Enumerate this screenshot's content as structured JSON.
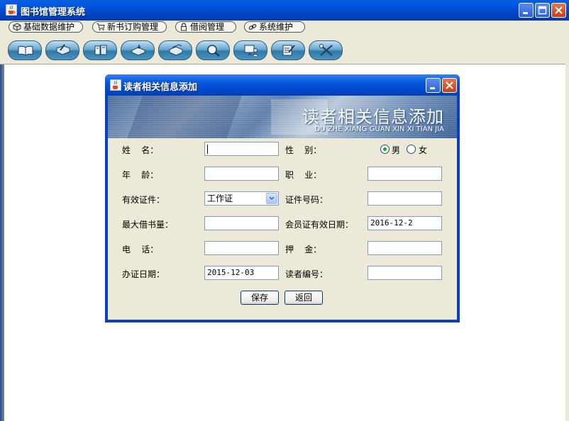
{
  "app": {
    "title": "图书馆管理系统"
  },
  "menu": [
    {
      "label": "基础数据维护",
      "icon": "cube-icon"
    },
    {
      "label": "新书订购管理",
      "icon": "cart-icon"
    },
    {
      "label": "借阅管理",
      "icon": "lock-icon"
    },
    {
      "label": "系统维护",
      "icon": "link-icon"
    }
  ],
  "toolbar": [
    {
      "icon": "open-book-icon"
    },
    {
      "icon": "book-pen-icon"
    },
    {
      "icon": "folders-icon"
    },
    {
      "icon": "book-return-icon"
    },
    {
      "icon": "books-stack-icon"
    },
    {
      "icon": "magnifier-icon"
    },
    {
      "icon": "monitor-user-icon"
    },
    {
      "icon": "notepad-pencil-icon"
    },
    {
      "icon": "tools-icon"
    }
  ],
  "dialog": {
    "title": "读者相关信息添加",
    "banner_title": "读者相关信息添加",
    "banner_subtitle": "DU ZHE XIANG GUAN XIN XI TIAN JIA",
    "labels": {
      "name": "姓    名：",
      "gender": "性    别：",
      "age": "年    龄：",
      "job": "职    业：",
      "id_type": "有效证件：",
      "id_number": "证件号码：",
      "max_borrow": "最大借书量：",
      "member_expiry": "会员证有效日期：",
      "phone": "电    话：",
      "deposit": "押    金：",
      "issue_date": "办证日期：",
      "reader_no": "读者编号："
    },
    "values": {
      "name": "",
      "age": "",
      "job": "",
      "id_type": "工作证",
      "id_number": "",
      "max_borrow": "",
      "member_expiry": "2016-12-2",
      "phone": "",
      "deposit": "",
      "issue_date": "2015-12-03",
      "reader_no": ""
    },
    "gender_options": [
      "男",
      "女"
    ],
    "gender_selected": "男",
    "buttons": {
      "save": "保存",
      "back": "返回"
    }
  }
}
